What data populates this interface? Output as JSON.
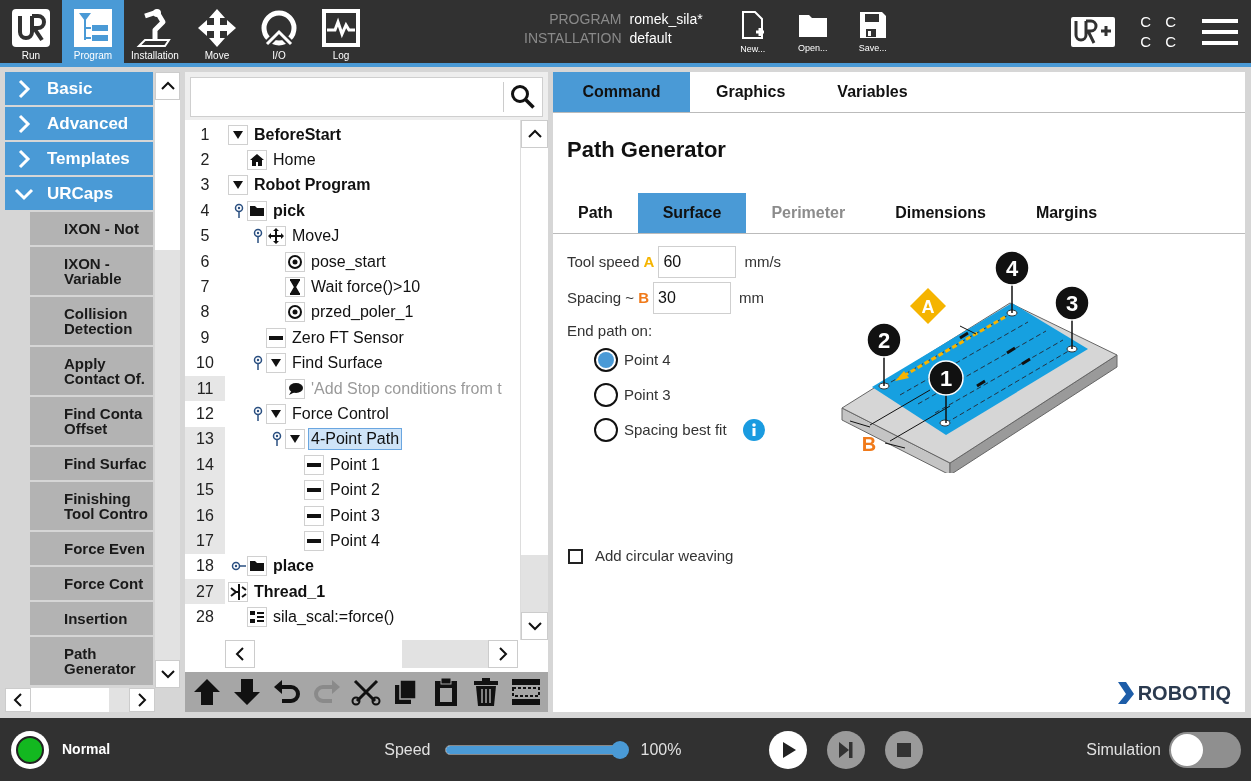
{
  "header": {
    "nav": [
      {
        "label": "Run",
        "selected": false
      },
      {
        "label": "Program",
        "selected": true
      },
      {
        "label": "Installation",
        "selected": false
      },
      {
        "label": "Move",
        "selected": false
      },
      {
        "label": "I/O",
        "selected": false
      },
      {
        "label": "Log",
        "selected": false
      }
    ],
    "program_label": "PROGRAM",
    "program_name": "romek_sila*",
    "installation_label": "INSTALLATION",
    "installation_name": "default",
    "file_buttons": [
      "New...",
      "Open...",
      "Save..."
    ],
    "indicator_letters": [
      "C",
      "C",
      "C",
      "C"
    ]
  },
  "toolbox": {
    "categories": [
      {
        "label": "Basic",
        "expanded": false
      },
      {
        "label": "Advanced",
        "expanded": false
      },
      {
        "label": "Templates",
        "expanded": false
      },
      {
        "label": "URCaps",
        "expanded": true,
        "items": [
          "IXON - Not",
          "IXON -\nVariable",
          "Collision\nDetection",
          "Apply\nContact Of.",
          "Find Conta\nOffset",
          "Find Surfac",
          "Finishing\nTool Contro",
          "Force Even",
          "Force Cont",
          "Insertion",
          "Path\nGenerator"
        ]
      }
    ]
  },
  "program_tree": {
    "nodes": [
      {
        "line": "1",
        "label": "BeforeStart",
        "kind": "section",
        "bold": true,
        "marked": false,
        "selected": false,
        "children": [
          {
            "line": "2",
            "label": "Home",
            "kind": "home",
            "bold": false,
            "marked": false,
            "selected": false
          }
        ]
      },
      {
        "line": "3",
        "label": "Robot Program",
        "kind": "section",
        "bold": true,
        "marked": false,
        "selected": false,
        "children": [
          {
            "line": "4",
            "label": "pick",
            "kind": "folder",
            "bold": true,
            "marked": false,
            "selected": false,
            "expanded": true,
            "children": [
              {
                "line": "5",
                "label": "MoveJ",
                "kind": "move",
                "bold": false,
                "marked": false,
                "selected": false,
                "expanded": true,
                "children": [
                  {
                    "line": "6",
                    "label": "pose_start",
                    "kind": "waypoint",
                    "bold": false,
                    "marked": false,
                    "selected": false
                  },
                  {
                    "line": "7",
                    "label": "Wait force()>10",
                    "kind": "wait",
                    "bold": false,
                    "marked": false,
                    "selected": false
                  },
                  {
                    "line": "8",
                    "label": "przed_poler_1",
                    "kind": "waypoint",
                    "bold": false,
                    "marked": false,
                    "selected": false
                  }
                ]
              },
              {
                "line": "9",
                "label": "Zero FT Sensor",
                "kind": "dash",
                "bold": false,
                "marked": false,
                "selected": false
              },
              {
                "line": "10",
                "label": "Find Surface",
                "kind": "section",
                "bold": false,
                "marked": false,
                "selected": false,
                "expanded": true,
                "children": [
                  {
                    "line": "11",
                    "label": "'Add Stop conditions from t",
                    "kind": "comment",
                    "bold": false,
                    "marked": true,
                    "selected": false
                  }
                ]
              },
              {
                "line": "12",
                "label": "Force Control",
                "kind": "section",
                "bold": false,
                "marked": false,
                "selected": false,
                "expanded": true,
                "children": [
                  {
                    "line": "13",
                    "label": "4-Point Path",
                    "kind": "section",
                    "bold": false,
                    "marked": true,
                    "selected": true,
                    "expanded": true,
                    "children": [
                      {
                        "line": "14",
                        "label": "Point 1",
                        "kind": "dash",
                        "bold": false,
                        "marked": true,
                        "selected": false
                      },
                      {
                        "line": "15",
                        "label": "Point 2",
                        "kind": "dash",
                        "bold": false,
                        "marked": true,
                        "selected": false
                      },
                      {
                        "line": "16",
                        "label": "Point 3",
                        "kind": "dash",
                        "bold": false,
                        "marked": true,
                        "selected": false
                      },
                      {
                        "line": "17",
                        "label": "Point 4",
                        "kind": "dash",
                        "bold": false,
                        "marked": true,
                        "selected": false
                      }
                    ]
                  }
                ]
              }
            ]
          },
          {
            "line": "18",
            "label": "place",
            "kind": "folder",
            "bold": true,
            "marked": false,
            "selected": false,
            "expanded": false
          }
        ]
      },
      {
        "line": "27",
        "label": "Thread_1",
        "kind": "thread",
        "bold": true,
        "marked": true,
        "selected": false,
        "children": [
          {
            "line": "28",
            "label": "sila_scal:=force()",
            "kind": "assign",
            "bold": false,
            "marked": false,
            "selected": false
          }
        ]
      }
    ]
  },
  "edit_toolbar": [
    {
      "disabled": false
    },
    {
      "disabled": false
    },
    {
      "disabled": false
    },
    {
      "disabled": true
    },
    {
      "disabled": false
    },
    {
      "disabled": false
    },
    {
      "disabled": false
    },
    {
      "disabled": false
    },
    {
      "disabled": false
    }
  ],
  "command_panel": {
    "tabs": [
      {
        "label": "Command",
        "selected": true
      },
      {
        "label": "Graphics",
        "selected": false
      },
      {
        "label": "Variables",
        "selected": false
      }
    ],
    "title": "Path Generator",
    "subtabs": [
      {
        "label": "Path",
        "selected": false,
        "disabled": false
      },
      {
        "label": "Surface",
        "selected": true,
        "disabled": false
      },
      {
        "label": "Perimeter",
        "selected": false,
        "disabled": true
      },
      {
        "label": "Dimensions",
        "selected": false,
        "disabled": false
      },
      {
        "label": "Margins",
        "selected": false,
        "disabled": false
      }
    ],
    "tool_speed": {
      "label": "Tool speed",
      "marker": "A",
      "value": "60",
      "unit": "mm/s"
    },
    "spacing": {
      "label": "Spacing ~",
      "marker": "B",
      "value": "30",
      "unit": "mm"
    },
    "end_path_on": {
      "label": "End path on:",
      "options": [
        {
          "label": "Point 4",
          "selected": true
        },
        {
          "label": "Point 3",
          "selected": false
        },
        {
          "label": "Spacing best fit",
          "selected": false,
          "info": true
        }
      ]
    },
    "diagram": {
      "points": [
        "1",
        "2",
        "3",
        "4"
      ],
      "speed_marker": "A",
      "spacing_marker": "B"
    },
    "circular_weaving": {
      "label": "Add circular weaving",
      "checked": false
    },
    "brand": "ROBOTIQ"
  },
  "footer": {
    "status": "Normal",
    "speed_label": "Speed",
    "speed": {
      "level": 1.0
    },
    "speed_reading": "100%",
    "playback": [
      {
        "disabled": false
      },
      {
        "disabled": true
      },
      {
        "disabled": true
      }
    ],
    "simulation": {
      "label": "Simulation",
      "on": false
    }
  }
}
